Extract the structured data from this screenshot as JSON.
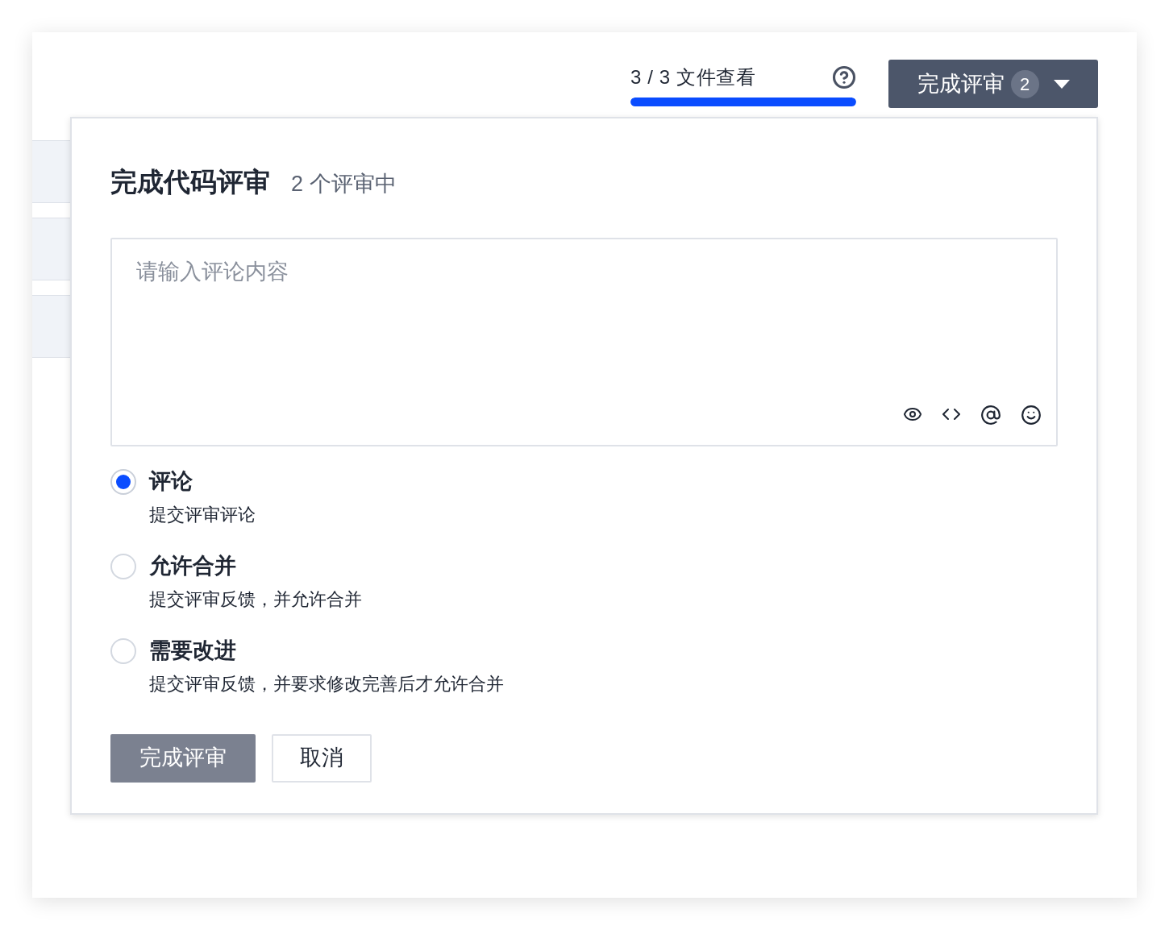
{
  "header": {
    "progress": {
      "label": "3 / 3 文件查看",
      "level": 1
    },
    "finish_button": {
      "label": "完成评审",
      "count": "2"
    }
  },
  "dialog": {
    "title": "完成代码评审",
    "subtitle": "2 个评审中",
    "comment": {
      "placeholder": "请输入评论内容"
    },
    "options": [
      {
        "label": "评论",
        "description": "提交评审评论",
        "selected": true
      },
      {
        "label": "允许合并",
        "description": "提交评审反馈，并允许合并",
        "selected": false
      },
      {
        "label": "需要改进",
        "description": "提交评审反馈，并要求修改完善后才允许合并",
        "selected": false
      }
    ],
    "buttons": [
      {
        "label": "完成评审",
        "kind": "primary"
      },
      {
        "label": "取消",
        "kind": "secondary"
      }
    ]
  }
}
